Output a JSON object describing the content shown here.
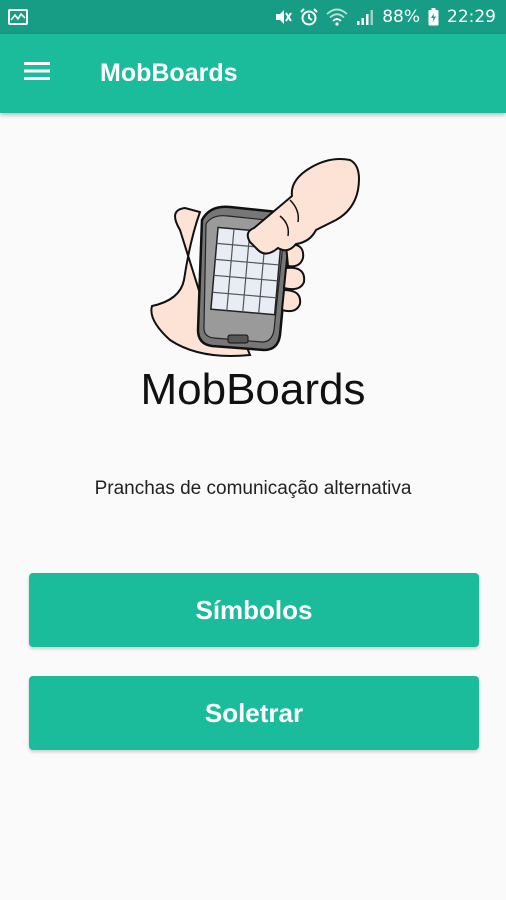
{
  "status_bar": {
    "battery": "88%",
    "time": "22:29",
    "icons": [
      "activity-icon",
      "mute-icon",
      "alarm-icon",
      "wifi-icon",
      "signal-icon",
      "battery-icon"
    ]
  },
  "app_bar": {
    "title": "MobBoards",
    "menu_icon": "hamburger-menu-icon"
  },
  "main": {
    "app_name": "MobBoards",
    "tagline": "Pranchas de comunicação alternativa",
    "buttons": [
      {
        "label": "Símbolos"
      },
      {
        "label": "Soletrar"
      }
    ]
  },
  "colors": {
    "primary": "#1abc9c",
    "status_bar": "#179c86",
    "background": "#fafafa"
  }
}
